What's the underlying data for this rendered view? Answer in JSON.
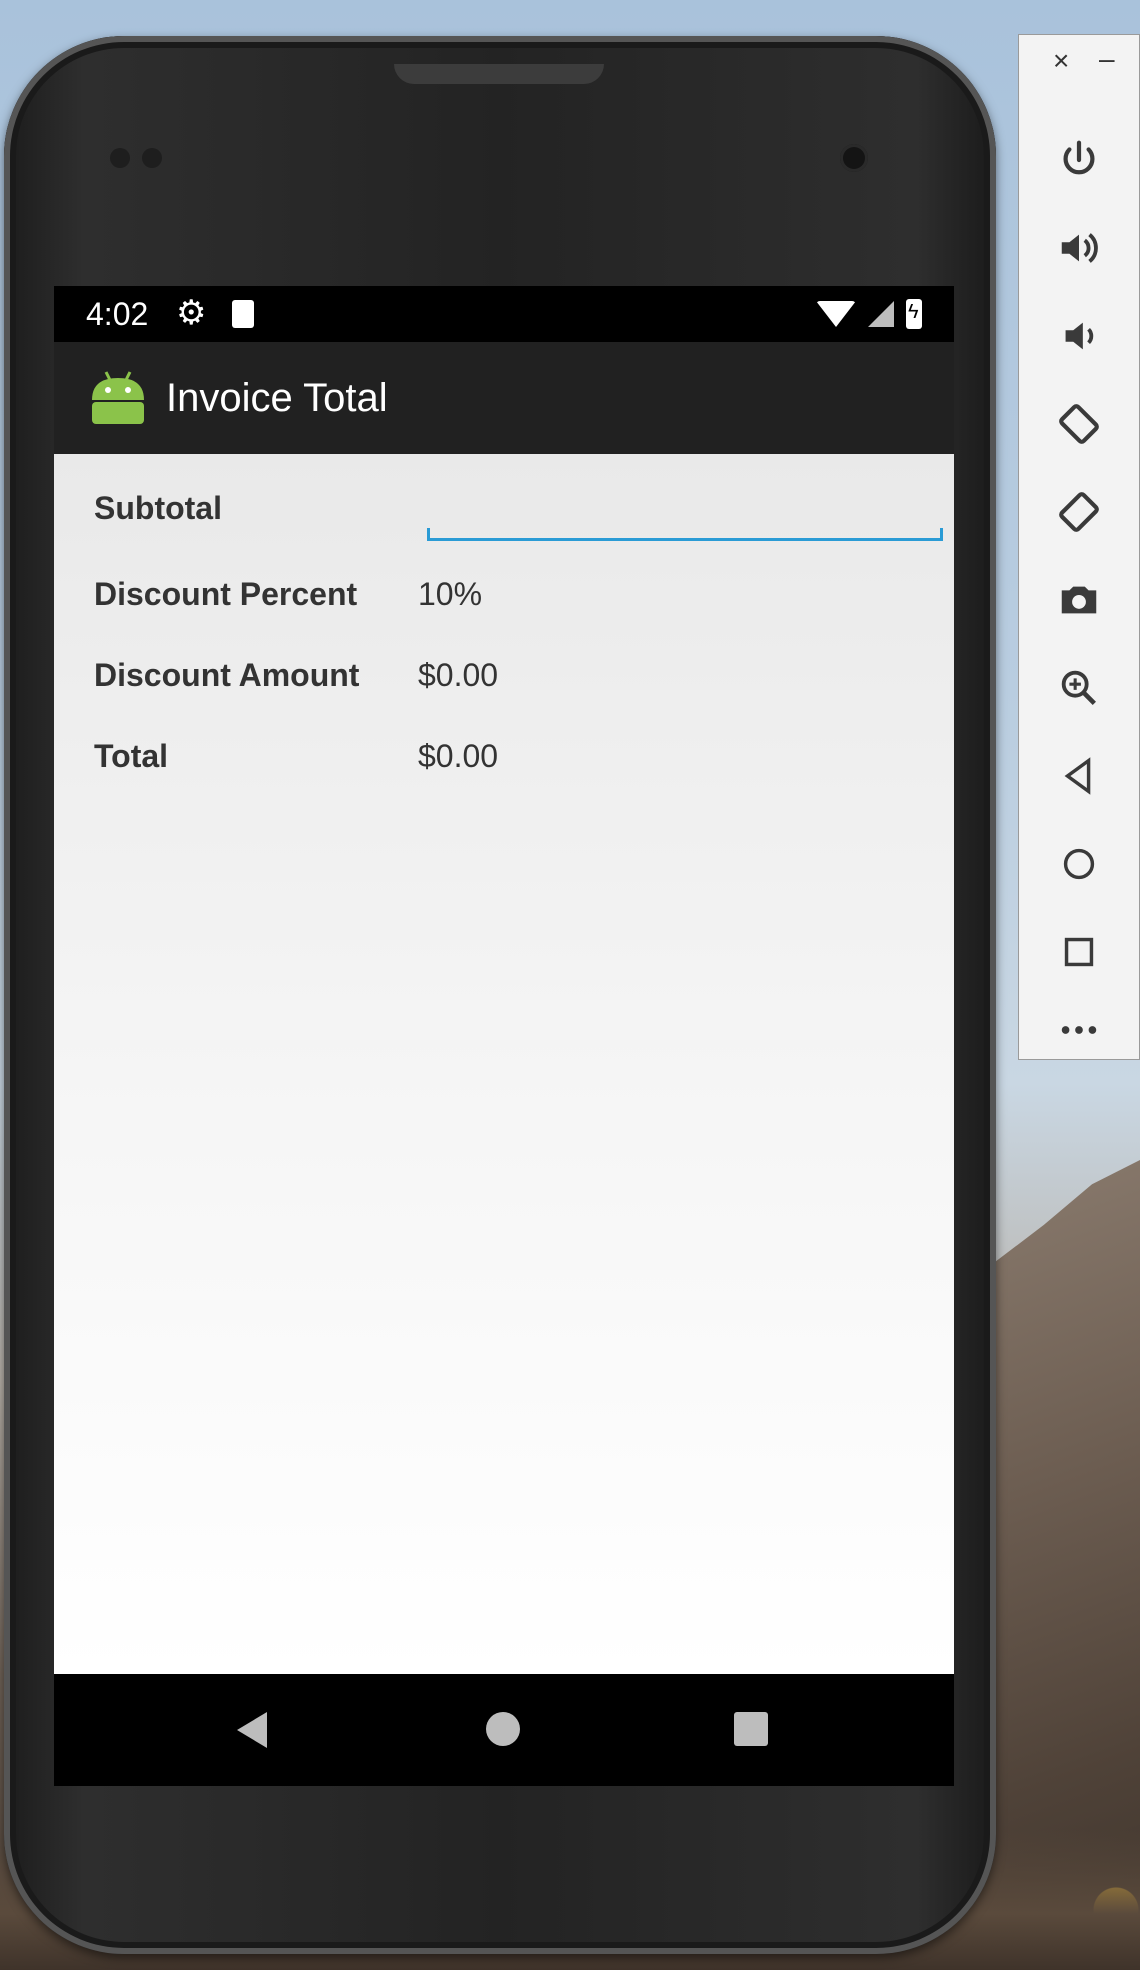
{
  "status_bar": {
    "time": "4:02",
    "icons": [
      "gear-icon",
      "sd-card-icon",
      "wifi-icon",
      "cell-signal-icon",
      "battery-charging-icon"
    ]
  },
  "app_bar": {
    "title": "Invoice Total",
    "icon": "android-icon",
    "icon_color": "#8bc34a"
  },
  "form": {
    "subtotal_label": "Subtotal",
    "subtotal_value": "",
    "discount_percent_label": "Discount Percent",
    "discount_percent_value": "10%",
    "discount_amount_label": "Discount Amount",
    "discount_amount_value": "$0.00",
    "total_label": "Total",
    "total_value": "$0.00"
  },
  "nav_bar": {
    "buttons": [
      "back-icon",
      "home-icon",
      "recents-icon"
    ]
  },
  "emulator_toolbar": {
    "close": "×",
    "minimize": "–",
    "buttons": [
      "power-icon",
      "volume-up-icon",
      "volume-down-icon",
      "rotate-left-icon",
      "rotate-right-icon",
      "camera-icon",
      "zoom-icon",
      "back-icon",
      "home-icon",
      "overview-icon",
      "more-icon"
    ]
  },
  "colors": {
    "accent": "#2a9bd5",
    "app_bar": "#212121",
    "android_green": "#8bc34a"
  }
}
